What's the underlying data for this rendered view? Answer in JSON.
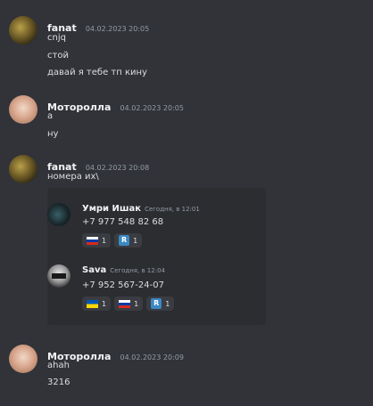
{
  "messages": [
    {
      "username": "fanat",
      "timestamp": "04.02.2023 20:05",
      "lines": [
        "cnjq",
        "стой",
        "давай я тебе тп кину"
      ]
    },
    {
      "username": "Моторолла",
      "timestamp": "04.02.2023 20:05",
      "lines": [
        "а",
        "ну"
      ]
    },
    {
      "username": "fanat",
      "timestamp": "04.02.2023 20:08",
      "lines": [
        "номера их\\"
      ],
      "forwarded": [
        {
          "username": "Умри Ишак",
          "timestamp": "Сегодня, в 12:01",
          "text": "+7 977 548 82 68",
          "reactions": [
            {
              "icon": "flag-russia",
              "count": "1"
            },
            {
              "icon": "regional-r",
              "letter": "R",
              "count": "1"
            }
          ]
        },
        {
          "username": "Sava",
          "timestamp": "Сегодня, в 12:04",
          "text": "+7 952 567-24-07",
          "reactions": [
            {
              "icon": "flag-ukraine",
              "count": "1"
            },
            {
              "icon": "flag-russia",
              "count": "1"
            },
            {
              "icon": "regional-r",
              "letter": "R",
              "count": "1"
            }
          ]
        }
      ]
    },
    {
      "username": "Моторолла",
      "timestamp": "04.02.2023 20:09",
      "lines": [
        "ahah",
        "3216"
      ]
    }
  ],
  "colors": {
    "background": "#313338",
    "embed_background": "#2b2d31",
    "username": "#f2f3f5",
    "timestamp": "#949ba4",
    "text": "#dbdee1"
  }
}
